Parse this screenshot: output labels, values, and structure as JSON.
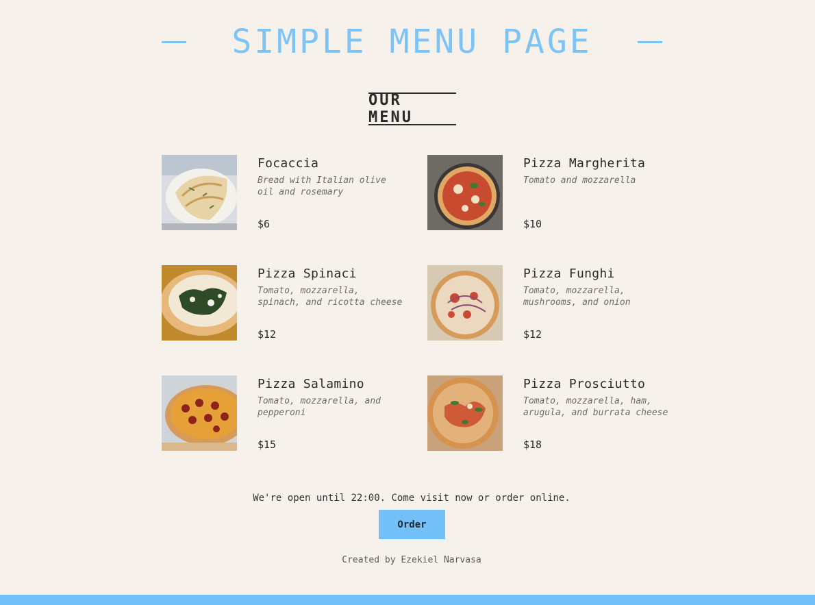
{
  "header": {
    "title": "SIMPLE MENU PAGE"
  },
  "menu": {
    "heading": "OUR MENU",
    "items": [
      {
        "name": "Focaccia",
        "description": "Bread with Italian olive oil and rosemary",
        "price": "$6",
        "image": "focaccia"
      },
      {
        "name": "Pizza Margherita",
        "description": "Tomato and mozzarella",
        "price": "$10",
        "image": "pizza-margherita"
      },
      {
        "name": "Pizza Spinaci",
        "description": "Tomato, mozzarella, spinach, and ricotta cheese",
        "price": "$12",
        "image": "pizza-spinaci"
      },
      {
        "name": "Pizza Funghi",
        "description": "Tomato, mozzarella, mushrooms, and onion",
        "price": "$12",
        "image": "pizza-funghi"
      },
      {
        "name": "Pizza Salamino",
        "description": "Tomato, mozzarella, and pepperoni",
        "price": "$15",
        "image": "pizza-salamino"
      },
      {
        "name": "Pizza Prosciutto",
        "description": "Tomato, mozzarella, ham, arugula, and burrata cheese",
        "price": "$18",
        "image": "pizza-prosciutto"
      }
    ]
  },
  "footer": {
    "open_text": "We're open until 22:00. Come visit now or order online.",
    "order_label": "Order",
    "credit": "Created by Ezekiel Narvasa"
  },
  "colors": {
    "accent": "#73c0f8",
    "background": "#f6f1ea",
    "text": "#2a2a2a"
  }
}
